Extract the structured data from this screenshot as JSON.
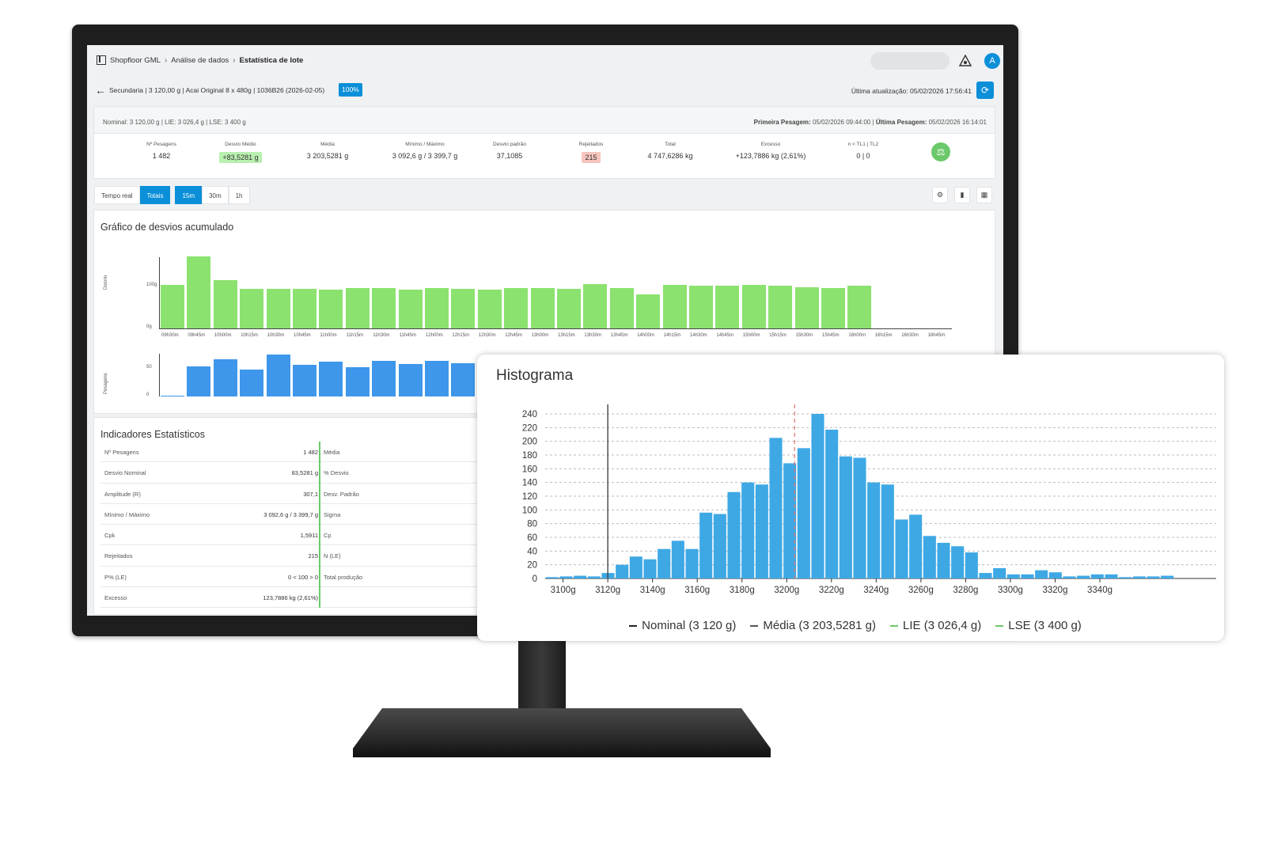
{
  "app": {
    "breadcrumb": [
      "Shopfloor GML",
      "Análise de dados",
      "Estatística de lote"
    ],
    "avatar_letter": "A",
    "batch_info": "Secundaria |  3 120,00 g  |  Acai Original 8 x 480g  |  1036B26  (2026-02-05)",
    "progress_badge": "100%",
    "last_update": "Última atualização: 05/02/2026 17:56:41"
  },
  "summary": {
    "spec_line": "Nominal: 3 120,00 g | LIE: 3 026,4 g | LSE: 3 400 g",
    "first_weighing_label": "Primeira Pesagem:",
    "first_weighing": "05/02/2026 09:44:00",
    "last_weighing_label": "Última Pesagem:",
    "last_weighing": "05/02/2026 16:14:01",
    "kpis": [
      {
        "label": "Nº Pesagens",
        "value": "1 482",
        "style": ""
      },
      {
        "label": "Desvio Médio",
        "value": "+83,5281 g",
        "style": "green"
      },
      {
        "label": "Média",
        "value": "3 203,5281 g",
        "style": ""
      },
      {
        "label": "Mínimo / Máximo",
        "value": "3 092,6 g / 3 399,7 g",
        "style": ""
      },
      {
        "label": "Desvio padrão",
        "value": "37,1085",
        "style": ""
      },
      {
        "label": "Rejeitados",
        "value": "215",
        "style": "red"
      },
      {
        "label": "Total",
        "value": "4 747,6286 kg",
        "style": ""
      },
      {
        "label": "Excesso",
        "value": "+123,7886 kg (2,61%)",
        "style": ""
      },
      {
        "label": "n < TL1 | TL2",
        "value": "0  |  0",
        "style": ""
      }
    ]
  },
  "tabs": {
    "mode": [
      "Tempo real",
      "Totais"
    ],
    "active_mode": "Totais",
    "interval": [
      "15m",
      "30m",
      "1h"
    ],
    "active_interval": "15m"
  },
  "deviation_chart": {
    "title": "Gráfico de desvios acumulado",
    "y_title_top": "Desvio",
    "y_title_bottom": "Pesagens",
    "y_ticks_top": [
      "100g",
      "0g"
    ],
    "y_ticks_bottom": [
      "50",
      "0"
    ],
    "chart_data": {
      "type": "bar",
      "categories": [
        "09h30m",
        "09h45m",
        "10h00m",
        "10h15m",
        "10h30m",
        "10h45m",
        "11h00m",
        "11h15m",
        "11h30m",
        "11h45m",
        "12h00m",
        "12h15m",
        "12h30m",
        "12h45m",
        "13h00m",
        "13h15m",
        "13h30m",
        "13h45m",
        "14h00m",
        "14h15m",
        "14h30m",
        "14h45m",
        "15h00m",
        "15h15m",
        "15h30m",
        "15h45m",
        "16h00m",
        "16h15m",
        "16h30m",
        "16h45m"
      ],
      "series": [
        {
          "values": [
            88,
            146,
            98,
            80,
            80,
            80,
            79,
            81,
            81,
            79,
            81,
            80,
            78,
            82,
            82,
            80,
            90,
            81,
            69,
            88,
            86,
            86,
            88,
            86,
            84,
            81,
            86,
            null,
            null,
            null
          ]
        },
        {
          "values": [
            1,
            40,
            50,
            36,
            56,
            42,
            47,
            39,
            48,
            44,
            48,
            45,
            null,
            null,
            null,
            null,
            null,
            null,
            null,
            null,
            null,
            null,
            null,
            null,
            null,
            null,
            null,
            null,
            null,
            null
          ]
        }
      ],
      "ylim_top": [
        0,
        160
      ],
      "ylim_bottom": [
        0,
        70
      ]
    }
  },
  "stats": {
    "title": "Indicadores Estatísticos",
    "rows": [
      {
        "k": "Nº Pesagens",
        "v": "1 482",
        "k2": "Média"
      },
      {
        "k": "Desvio Nominal",
        "v": "83,5281 g",
        "k2": "% Desvio"
      },
      {
        "k": "Amplitude (R)",
        "v": "307,1",
        "k2": "Desv. Padrão"
      },
      {
        "k": "Mínimo / Máximo",
        "v": "3 092,6 g / 3 399,7 g",
        "k2": "Sigma"
      },
      {
        "k": "Cpk",
        "v": "1,5911",
        "k2": "Cp"
      },
      {
        "k": "Rejeitados",
        "v": "215",
        "k2": "N (LE)"
      },
      {
        "k": "P% (LE)",
        "v": "0 < 100 > 0",
        "k2": "Total produção"
      },
      {
        "k": "Excesso",
        "v": "123,7886 kg (2,61%)",
        "k2": ""
      }
    ]
  },
  "histogram": {
    "title": "Histograma",
    "legend": [
      {
        "label": "Nominal (3 120 g)",
        "color": "#222222"
      },
      {
        "label": "Média (3 203,5281 g)",
        "color": "#555555"
      },
      {
        "label": "LIE (3 026,4 g)",
        "color": "#6cc96a"
      },
      {
        "label": "LSE (3 400 g)",
        "color": "#6cc96a"
      }
    ],
    "chart_data": {
      "type": "bar",
      "x_tick_labels": [
        "3100g",
        "3120g",
        "3140g",
        "3160g",
        "3180g",
        "3200g",
        "3220g",
        "3240g",
        "3260g",
        "3280g",
        "3300g",
        "3320g",
        "3340g"
      ],
      "y_ticks": [
        0,
        20,
        40,
        60,
        80,
        100,
        120,
        140,
        160,
        180,
        200,
        220,
        240
      ],
      "ylim": [
        0,
        240
      ],
      "xlim": [
        3092,
        3392
      ],
      "bin_width": 6.25,
      "values": [
        2,
        3,
        4,
        3,
        8,
        20,
        32,
        28,
        43,
        55,
        43,
        96,
        94,
        126,
        140,
        137,
        205,
        168,
        190,
        240,
        217,
        178,
        176,
        140,
        137,
        86,
        93,
        62,
        52,
        47,
        38,
        8,
        15,
        6,
        6,
        12,
        9,
        3,
        4,
        6,
        6,
        2,
        3,
        3,
        4
      ],
      "nominal": 3120,
      "mean": 3203.5281,
      "grid": true
    }
  }
}
